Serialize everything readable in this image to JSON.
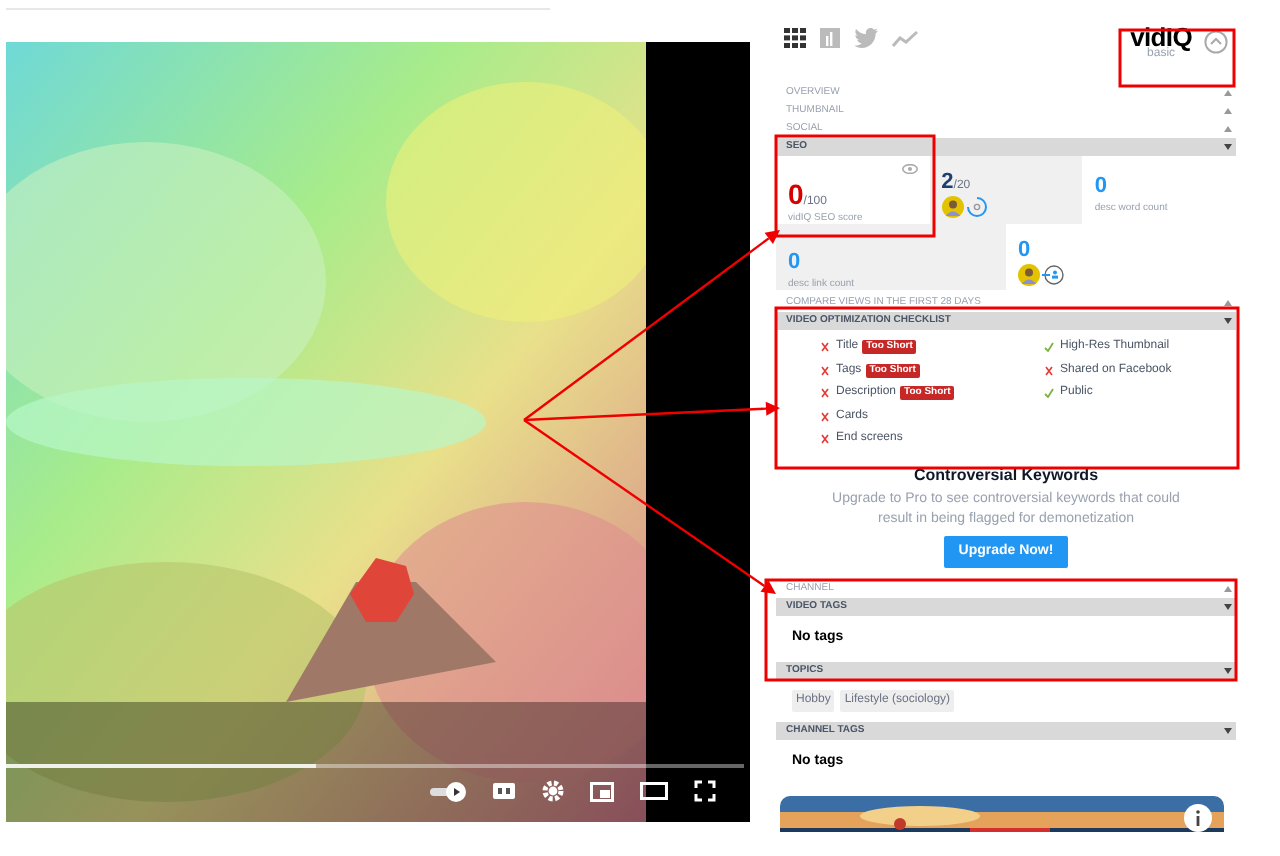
{
  "video": {
    "progress": {
      "level": 0.42
    }
  },
  "header": {
    "logo": "vidIQ",
    "plan": "basic"
  },
  "blocks": [
    {
      "kind": "section",
      "title": "OVERVIEW",
      "expanded": false
    },
    {
      "kind": "section",
      "title": "THUMBNAIL",
      "expanded": false
    },
    {
      "kind": "section",
      "title": "SOCIAL",
      "expanded": false
    },
    {
      "kind": "section",
      "title": "SEO",
      "expanded": true,
      "content": {
        "kind": "stats",
        "rows": [
          [
            {
              "kind": "score",
              "value": "0",
              "suffix": "/100",
              "label": "vidIQ SEO score"
            },
            {
              "kind": "ratio",
              "value": "2",
              "suffix": "/20"
            },
            {
              "kind": "count",
              "value": "0",
              "label": "desc word count"
            }
          ],
          [
            {
              "kind": "count",
              "value": "0",
              "label": "desc link count"
            },
            {
              "kind": "compare",
              "value": "0"
            }
          ]
        ]
      }
    },
    {
      "kind": "section",
      "title": "COMPARE VIEWS IN THE FIRST 28 DAYS",
      "expanded": false
    },
    {
      "kind": "section",
      "title": "VIDEO OPTIMIZATION CHECKLIST",
      "expanded": true,
      "content": {
        "kind": "checklist",
        "columns": [
          [
            {
              "label": "Title",
              "passed": false,
              "badge": "Too Short"
            },
            {
              "label": "Tags",
              "passed": false,
              "badge": "Too Short"
            },
            {
              "label": "Description",
              "passed": false,
              "badge": "Too Short"
            },
            {
              "label": "Cards",
              "passed": false
            },
            {
              "label": "End screens",
              "passed": false
            }
          ],
          [
            {
              "label": "High-Res Thumbnail",
              "passed": true
            },
            {
              "label": "Shared on Facebook",
              "passed": false
            },
            {
              "label": "Public",
              "passed": true
            }
          ]
        ]
      }
    },
    {
      "kind": "promo",
      "title": "Controversial Keywords",
      "text": "Upgrade to Pro to see controversial keywords that could result in being flagged for demonetization",
      "button": "Upgrade Now!"
    },
    {
      "kind": "section",
      "title": "CHANNEL",
      "expanded": false
    },
    {
      "kind": "section",
      "title": "VIDEO TAGS",
      "expanded": true,
      "content": {
        "kind": "text",
        "text": "No tags"
      }
    },
    {
      "kind": "section",
      "title": "TOPICS",
      "expanded": true,
      "content": {
        "kind": "chips",
        "chips": [
          "Hobby",
          "Lifestyle (sociology)"
        ]
      }
    },
    {
      "kind": "section",
      "title": "CHANNEL TAGS",
      "expanded": true,
      "content": {
        "kind": "text",
        "text": "No tags"
      }
    },
    {
      "kind": "banner"
    }
  ]
}
